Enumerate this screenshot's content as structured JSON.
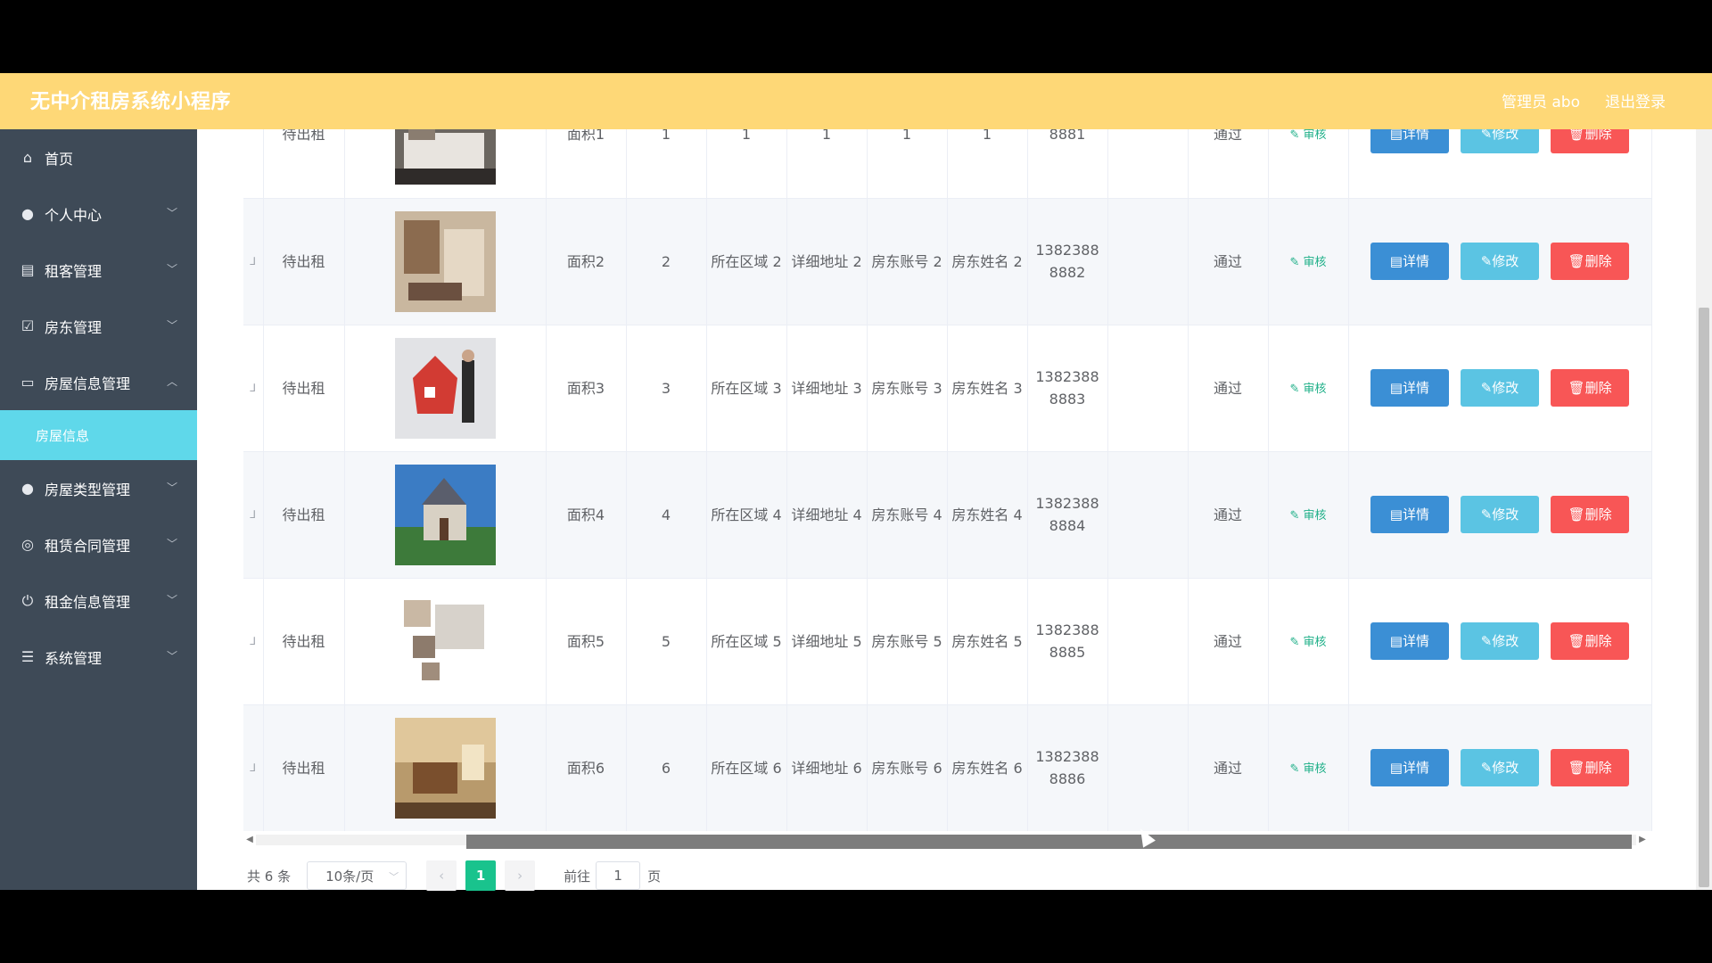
{
  "header": {
    "title": "无中介租房系统小程序",
    "admin_label": "管理员 abo",
    "logout_label": "退出登录"
  },
  "sidebar": {
    "items": [
      {
        "label": "首页",
        "icon": "home-icon"
      },
      {
        "label": "个人中心",
        "icon": "user-icon"
      },
      {
        "label": "租客管理",
        "icon": "folder-icon"
      },
      {
        "label": "房东管理",
        "icon": "check-icon"
      },
      {
        "label": "房屋信息管理",
        "icon": "card-icon"
      },
      {
        "label": "房屋类型管理",
        "icon": "user-icon"
      },
      {
        "label": "租赁合同管理",
        "icon": "compass-icon"
      },
      {
        "label": "租金信息管理",
        "icon": "power-icon"
      },
      {
        "label": "系统管理",
        "icon": "menu-icon"
      }
    ],
    "active_sub": "房屋信息"
  },
  "table": {
    "first_row_partial": {
      "status": "待出租",
      "area": "面积1",
      "num": "1",
      "region": "1",
      "address": "1",
      "account": "1",
      "name": "1",
      "phone": "8881",
      "audit": "通过"
    },
    "rows": [
      {
        "status": "待出租",
        "area": "面积2",
        "num": "2",
        "region": "所在区域 2",
        "address": "详细地址 2",
        "account": "房东账号 2",
        "name": "房东姓名 2",
        "phone": "1382388 8882",
        "audit": "通过"
      },
      {
        "status": "待出租",
        "area": "面积3",
        "num": "3",
        "region": "所在区域 3",
        "address": "详细地址 3",
        "account": "房东账号 3",
        "name": "房东姓名 3",
        "phone": "1382388 8883",
        "audit": "通过"
      },
      {
        "status": "待出租",
        "area": "面积4",
        "num": "4",
        "region": "所在区域 4",
        "address": "详细地址 4",
        "account": "房东账号 4",
        "name": "房东姓名 4",
        "phone": "1382388 8884",
        "audit": "通过"
      },
      {
        "status": "待出租",
        "area": "面积5",
        "num": "5",
        "region": "所在区域 5",
        "address": "详细地址 5",
        "account": "房东账号 5",
        "name": "房东姓名 5",
        "phone": "1382388 8885",
        "audit": "通过"
      },
      {
        "status": "待出租",
        "area": "面积6",
        "num": "6",
        "region": "所在区域 6",
        "address": "详细地址 6",
        "account": "房东账号 6",
        "name": "房东姓名 6",
        "phone": "1382388 8886",
        "audit": "通过"
      }
    ],
    "audit_label": "审核",
    "detail_label": "详情",
    "edit_label": "修改",
    "delete_label": "删除"
  },
  "pagination": {
    "total": "共 6 条",
    "page_size": "10条/页",
    "current_page": "1",
    "goto_label": "前往",
    "goto_value": "1",
    "page_suffix": "页"
  }
}
